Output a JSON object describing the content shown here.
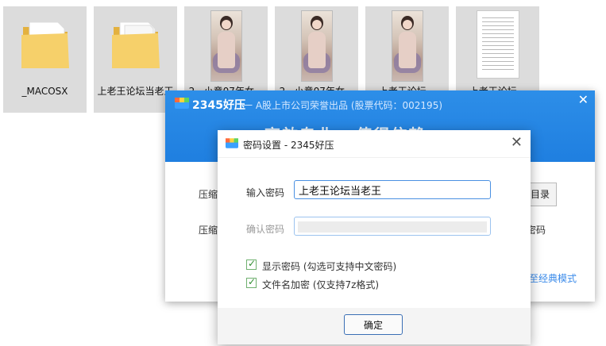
{
  "explorer": {
    "items": [
      {
        "label": "_MACOSX",
        "type": "folder"
      },
      {
        "label": "上老王论坛当老王",
        "type": "folder"
      },
      {
        "label": "2...小意07年女...",
        "type": "photo"
      },
      {
        "label": "2...小意07年女...",
        "type": "photo"
      },
      {
        "label": "上老王论坛...",
        "type": "photo"
      },
      {
        "label": "上老王论坛...",
        "type": "document"
      }
    ]
  },
  "main_window": {
    "brand": "2345好压",
    "tagline": "一 A股上市公司荣誉出品 (股票代码：002195)",
    "close_glyph": "✕",
    "banner_text": "高效专业 · 值得信赖",
    "row1_label": "压缩",
    "row2_label": "压缩",
    "dir_button": "目录",
    "password_text": "密码",
    "classic_link": "至经典模式"
  },
  "dialog": {
    "title": "密码设置 - 2345好压",
    "close_glyph": "✕",
    "password_label": "输入密码",
    "password_value": "上老王论坛当老王",
    "confirm_label": "确认密码",
    "confirm_value": "",
    "show_password": {
      "label": "显示密码 (勾选可支持中文密码)",
      "checked": true
    },
    "encrypt_names": {
      "label": "文件名加密 (仅支持7z格式)",
      "checked": true
    },
    "ok_button": "确定"
  },
  "colors": {
    "titlebar_blue": "#2d8ee8",
    "input_border": "#4a90e2",
    "check_green": "#2f8d2f",
    "link_blue": "#3b8bea",
    "folder_yellow": "#f6d06a"
  },
  "icons": {
    "folder": "folder-icon",
    "photo": "image-file-icon",
    "document": "document-icon",
    "app_logo": "2345-logo-icon",
    "check": "checkmark-icon"
  }
}
